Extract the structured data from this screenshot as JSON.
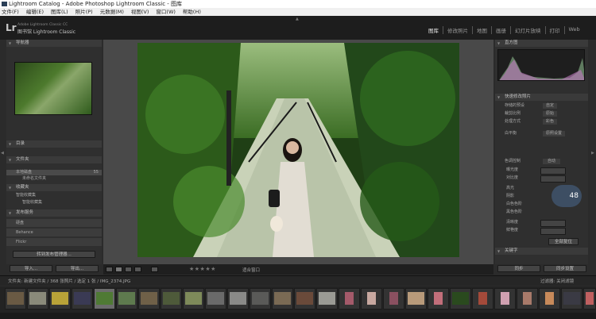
{
  "window": {
    "title": "Lightroom Catalog - Adobe Photoshop Lightroom Classic - 图库"
  },
  "menu": [
    "文件(F)",
    "编辑(E)",
    "图库(L)",
    "照片(P)",
    "元数据(M)",
    "视图(V)",
    "窗口(W)",
    "帮助(H)"
  ],
  "identity": {
    "logo": "Lr",
    "catalog": "Adobe Lightroom Classic CC",
    "module_name": "图书馆 Lightroom Classic"
  },
  "modules": [
    "图库",
    "修改照片",
    "地图",
    "画册",
    "幻灯片放映",
    "打印",
    "Web"
  ],
  "active_module": "图库",
  "left_panel": {
    "navigator": "导航器",
    "catalog": "目录",
    "folders": "文件夹",
    "folder_row": "本地磁盘",
    "folder_count": "55",
    "folder_sub": "未命名文件夹",
    "collections": "收藏夹",
    "coll_1": "智能收藏集",
    "coll_2": "智能收藏集",
    "publish": "发布服务",
    "publish_1": "硬盘",
    "publish_2": "Behance",
    "publish_3": "Flickr",
    "publish_btn": "转到发布管理器...",
    "import_btn": "导入...",
    "export_btn": "导出..."
  },
  "right_panel": {
    "histogram": "直方图",
    "quick_develop": "快速修改照片",
    "saved_preset": "存储的预设",
    "preset_value": "自定",
    "crop": "裁剪比例",
    "crop_value": "原始",
    "treatment": "处理方式",
    "treatment_value": "彩色",
    "white_balance": "白平衡",
    "wb_value": "原照设置",
    "tone_control": "色调控制",
    "auto_tone": "自动",
    "rows": [
      "曝光度",
      "对比度",
      "高光",
      "阴影",
      "白色色阶",
      "黑色色阶",
      "清晰度",
      "鲜艳度"
    ],
    "reset_btn": "全部复位",
    "keywords": "关键字",
    "sync_btn": "同步",
    "sync_settings": "同步设置"
  },
  "toolbar": {
    "stars": "★★★★★",
    "zoom_label": "适合窗口"
  },
  "filmstrip": {
    "path": "文件夹: 新建文件夹 / 368 张照片 / 选定 1 张 / IMG_2374.JPG",
    "filter": "过滤器: 关闭滤镜"
  },
  "overlay": {
    "zoom_bubble": "48"
  },
  "colors": {
    "panel_bg": "#2f2f2f",
    "center_bg": "#494949",
    "accent_bubble": "#3d4e63"
  }
}
